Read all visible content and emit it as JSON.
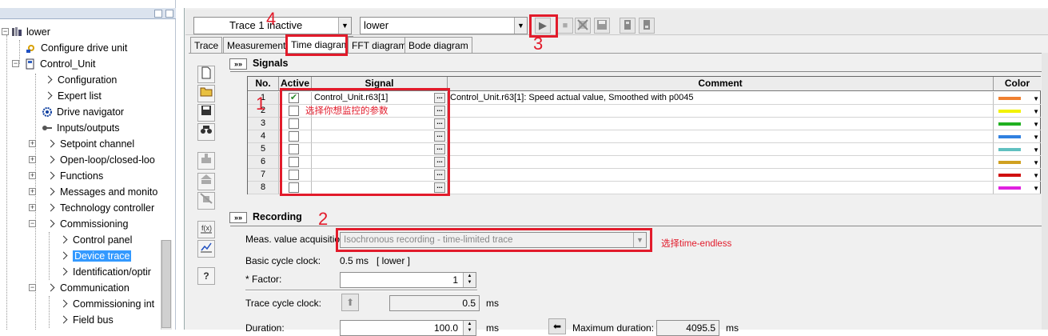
{
  "tree": {
    "items": [
      {
        "label": "lower",
        "icon": "drive-icon"
      },
      {
        "label": "Configure drive unit",
        "icon": "configure-icon"
      },
      {
        "label": "Control_Unit",
        "icon": "control-unit-icon"
      },
      {
        "label": "Configuration"
      },
      {
        "label": "Expert list"
      },
      {
        "label": "Drive navigator",
        "icon": "navigator-icon"
      },
      {
        "label": "Inputs/outputs",
        "icon": "io-icon"
      },
      {
        "label": "Setpoint channel"
      },
      {
        "label": "Open-loop/closed-loo"
      },
      {
        "label": "Functions"
      },
      {
        "label": "Messages and monito"
      },
      {
        "label": "Technology controller"
      },
      {
        "label": "Commissioning"
      },
      {
        "label": "Control panel"
      },
      {
        "label": "Device trace",
        "selected": true
      },
      {
        "label": "Identification/optir"
      },
      {
        "label": "Communication"
      },
      {
        "label": "Commissioning int"
      },
      {
        "label": "Field bus"
      }
    ]
  },
  "toolbar": {
    "trace_select": "Trace 1 inactive",
    "device_select": "lower"
  },
  "tabs": [
    "Trace",
    "Measurements",
    "Time diagram",
    "FFT diagram",
    "Bode diagram"
  ],
  "signals": {
    "title": "Signals",
    "columns": {
      "no": "No.",
      "active": "Active",
      "signal": "Signal",
      "comment": "Comment",
      "color": "Color"
    },
    "rows": [
      {
        "no": "1",
        "active": true,
        "signal": "Control_Unit.r63[1]",
        "comment": "Control_Unit.r63[1]: Speed actual value, Smoothed with p0045",
        "color": "#f08030"
      },
      {
        "no": "2",
        "active": false,
        "signal": "",
        "comment": "",
        "color": "#f2f200"
      },
      {
        "no": "3",
        "active": false,
        "signal": "",
        "comment": "",
        "color": "#20b020"
      },
      {
        "no": "4",
        "active": false,
        "signal": "",
        "comment": "",
        "color": "#3080e0"
      },
      {
        "no": "5",
        "active": false,
        "signal": "",
        "comment": "",
        "color": "#60c0c0"
      },
      {
        "no": "6",
        "active": false,
        "signal": "",
        "comment": "",
        "color": "#d0a020"
      },
      {
        "no": "7",
        "active": false,
        "signal": "",
        "comment": "",
        "color": "#d01010"
      },
      {
        "no": "8",
        "active": false,
        "signal": "",
        "comment": "",
        "color": "#e020e0"
      }
    ]
  },
  "recording": {
    "title": "Recording",
    "meas_label": "Meas. value acquisition:",
    "meas_value": "Isochronous recording - time-limited trace",
    "basic_cycle_label": "Basic cycle clock:",
    "basic_cycle_value": "0.5 ms",
    "basic_cycle_device": "[ lower ]",
    "factor_label": "* Factor:",
    "factor_value": "1",
    "trace_cycle_label": "Trace cycle clock:",
    "trace_cycle_value": "0.5",
    "trace_cycle_unit": "ms",
    "duration_label": "Duration:",
    "duration_value": "100.0",
    "duration_unit": "ms",
    "max_duration_label": "Maximum duration:",
    "max_duration_value": "4095.5",
    "max_duration_unit": "ms"
  },
  "annotations": {
    "n1": "1",
    "n1_text": "选择你想监控的参数",
    "n2": "2",
    "n2_text": "选择time-endless",
    "n3": "3",
    "n4": "4"
  },
  "help_label": "?"
}
